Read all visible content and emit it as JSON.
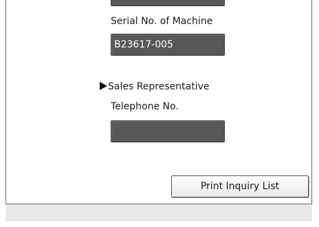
{
  "inquiry": {
    "serial_label": "Serial No. of Machine",
    "serial_value": "B23617-005",
    "section_title": "Sales Representative",
    "telephone_label": "Telephone No.",
    "telephone_value": "",
    "print_button_label": "Print Inquiry List"
  },
  "colors": {
    "field_background": "#585858",
    "field_text": "#ffffff",
    "panel_border": "#6a6a6a"
  }
}
